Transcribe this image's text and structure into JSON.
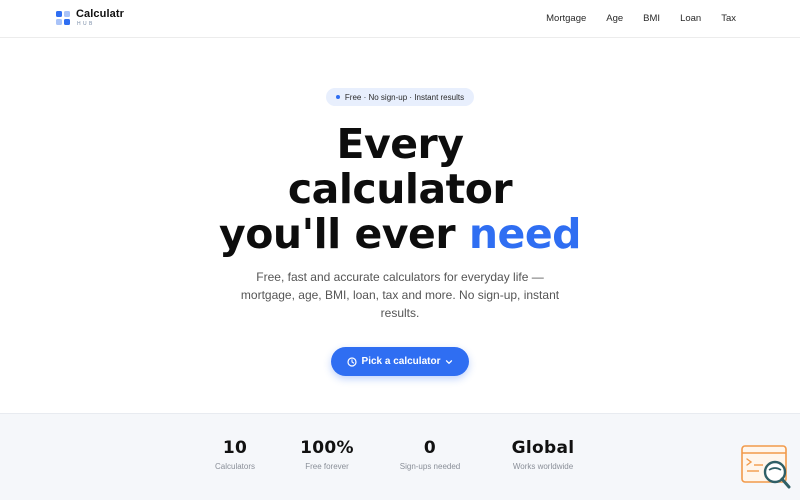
{
  "brand": {
    "name": "Calculatr",
    "sub": "HUB"
  },
  "nav": {
    "items": [
      {
        "label": "Mortgage"
      },
      {
        "label": "Age"
      },
      {
        "label": "BMI"
      },
      {
        "label": "Loan"
      },
      {
        "label": "Tax"
      }
    ]
  },
  "hero": {
    "badge": "Free · No sign-up · Instant results",
    "headline_line1": "Every",
    "headline_line2": "calculator",
    "headline_line3_plain": "you'll ever ",
    "headline_line3_accent": "need",
    "subtitle": "Free, fast and accurate calculators for everyday life — mortgage, age, BMI, loan, tax and more. No sign-up, instant results.",
    "cta_label": "Pick a calculator"
  },
  "stats": [
    {
      "value": "10",
      "label": "Calculators"
    },
    {
      "value": "100%",
      "label": "Free forever"
    },
    {
      "value": "0",
      "label": "Sign-ups needed"
    },
    {
      "value": "Global",
      "label": "Works worldwide"
    }
  ],
  "colors": {
    "accent": "#2f6ef2",
    "badge_bg": "#e8effd",
    "stats_bg": "#f5f7fa",
    "widget_orange": "#f29a4a",
    "widget_teal": "#2f5f66"
  },
  "icons": {
    "logo": "grid-squares-icon",
    "cta_left": "clock-icon",
    "cta_right": "chevron-down-icon",
    "widget": "search-feedback-icon"
  }
}
